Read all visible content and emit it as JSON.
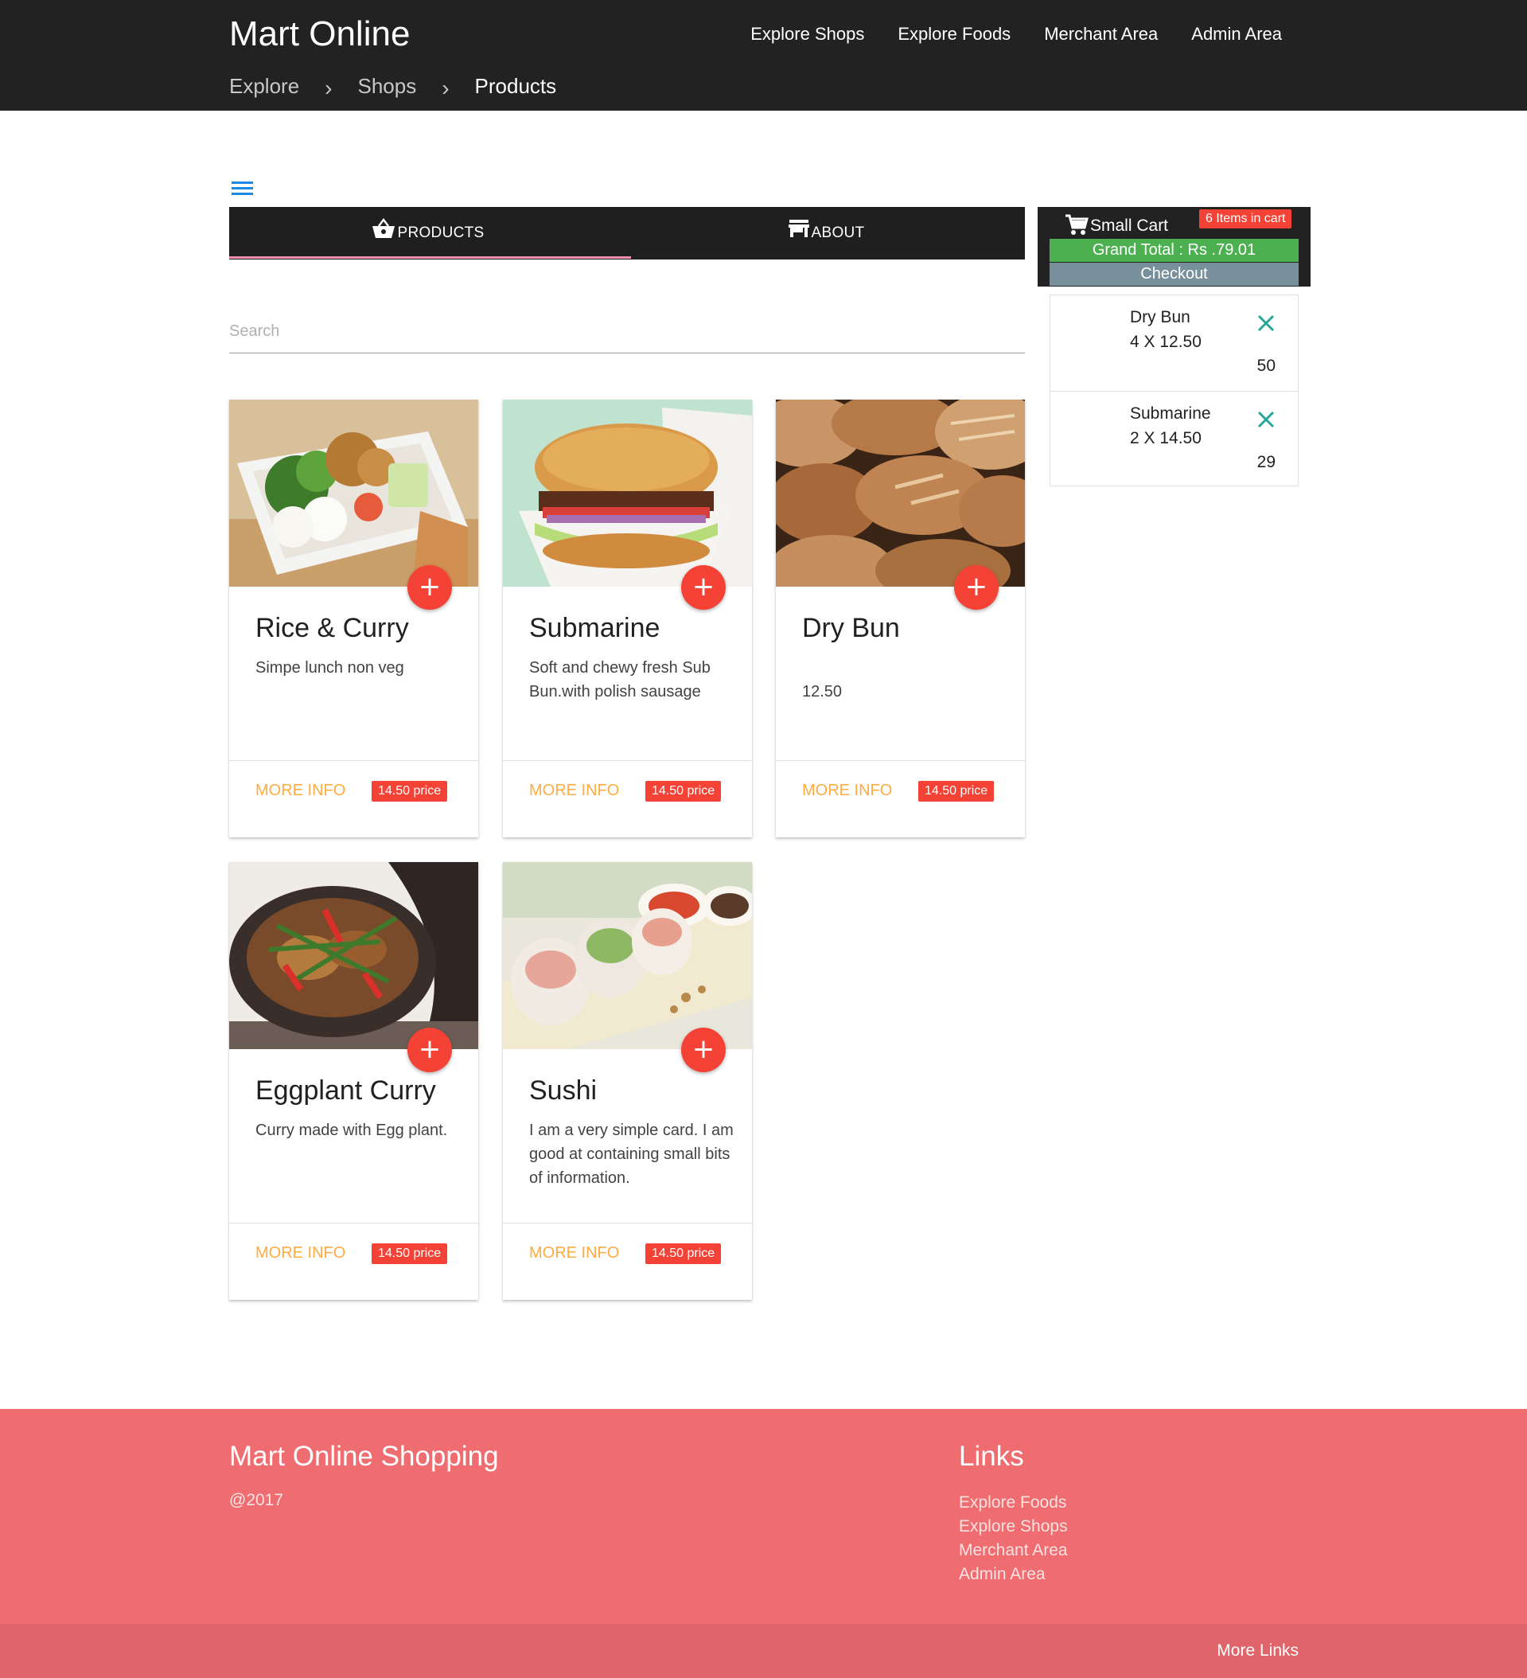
{
  "header": {
    "brand": "Mart Online",
    "nav": [
      "Explore Shops",
      "Explore Foods",
      "Merchant Area",
      "Admin Area"
    ],
    "breadcrumb": [
      "Explore",
      "Shops",
      "Products"
    ],
    "breadcrumb_separator": "›"
  },
  "tabs": [
    {
      "label": "PRODUCTS",
      "icon": "shopping-basket-icon",
      "active": true
    },
    {
      "label": "ABOUT",
      "icon": "store-icon",
      "active": false
    }
  ],
  "search": {
    "placeholder": "Search",
    "value": ""
  },
  "products": [
    {
      "title": "Rice & Curry",
      "desc": "Simpe lunch non veg",
      "more": "MORE INFO",
      "price": "14.50 price",
      "add": "+"
    },
    {
      "title": "Submarine",
      "desc": "Soft and chewy fresh Sub Bun.with polish sausage",
      "more": "MORE INFO",
      "price": "14.50 price",
      "add": "+"
    },
    {
      "title": "Dry Bun",
      "desc": "12.50",
      "more": "MORE INFO",
      "price": "14.50 price",
      "add": "+"
    },
    {
      "title": "Eggplant Curry",
      "desc": "Curry made with Egg plant.",
      "more": "MORE INFO",
      "price": "14.50 price",
      "add": "+"
    },
    {
      "title": "Sushi",
      "desc": "I am a very simple card. I am good at containing small bits of information.",
      "more": "MORE INFO",
      "price": "14.50 price",
      "add": "+"
    }
  ],
  "cart": {
    "title": "Small Cart",
    "badge": "6 Items in cart",
    "grand_total": "Grand Total : Rs .79.01",
    "checkout": "Checkout",
    "items": [
      {
        "name": "Dry Bun",
        "qty": "4 X 12.50",
        "amount": "50"
      },
      {
        "name": "Submarine",
        "qty": "2 X 14.50",
        "amount": "29"
      }
    ]
  },
  "footer": {
    "title": "Mart Online Shopping",
    "year": "@2017",
    "links_title": "Links",
    "links": [
      "Explore Foods",
      "Explore Shops",
      "Merchant Area",
      "Admin Area"
    ],
    "more_links": "More Links"
  },
  "colors": {
    "header_bg": "#222222",
    "accent_red": "#f44336",
    "more_info": "#ffab40",
    "grand_total_bg": "#4caf50",
    "checkout_bg": "#78909c",
    "footer_bg": "#ef6d70",
    "menu_icon": "#1e88e5"
  }
}
